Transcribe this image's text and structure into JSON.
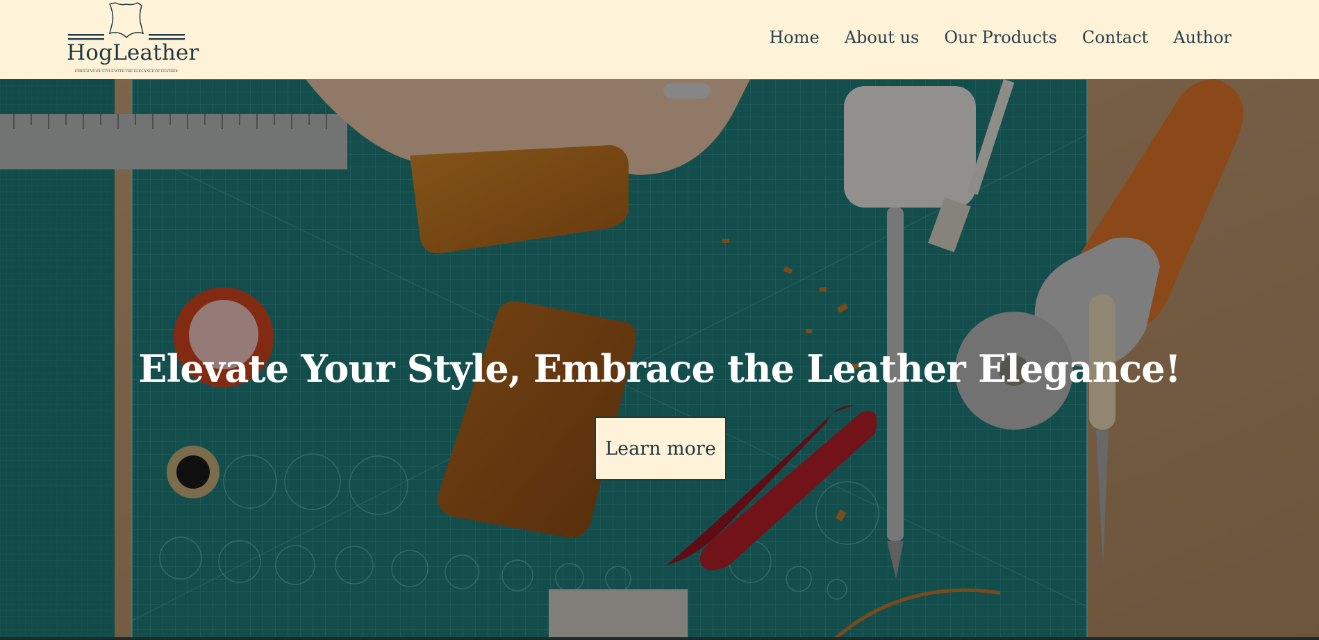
{
  "brand": {
    "name": "HogLeather",
    "tagline": "Enrich your style with the elegance of leather"
  },
  "nav": {
    "items": [
      "Home",
      "About us",
      "Our Products",
      "Contact",
      "Author"
    ]
  },
  "hero": {
    "headline": "Elevate Your Style, Embrace the Leather Elegance!",
    "cta_label": "Learn more"
  },
  "colors": {
    "cream": "#fef3d8",
    "navy_text": "#213a44",
    "cutting_mat": "#1f7a7a",
    "leather": "#b86a1e"
  }
}
